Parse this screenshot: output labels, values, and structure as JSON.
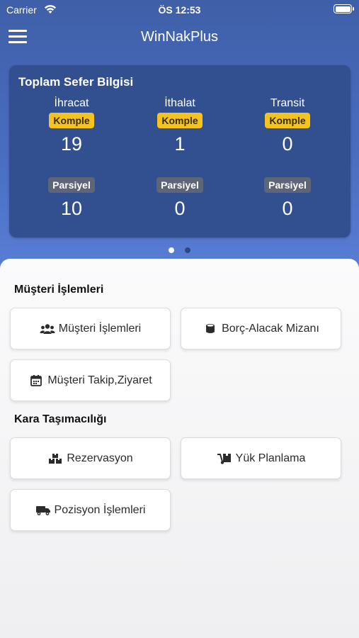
{
  "status_bar": {
    "carrier": "Carrier",
    "time": "ÖS 12:53"
  },
  "navbar": {
    "title": "WinNakPlus"
  },
  "summary": {
    "title": "Toplam Sefer Bilgisi",
    "columns": [
      {
        "label": "İhracat",
        "komple_badge": "Komple",
        "komple": "19",
        "parsiyel_badge": "Parsiyel",
        "parsiyel": "10"
      },
      {
        "label": "İthalat",
        "komple_badge": "Komple",
        "komple": "1",
        "parsiyel_badge": "Parsiyel",
        "parsiyel": "0"
      },
      {
        "label": "Transit",
        "komple_badge": "Komple",
        "komple": "0",
        "parsiyel_badge": "Parsiyel",
        "parsiyel": "0"
      }
    ]
  },
  "pager": {
    "pages": 2,
    "active": 1
  },
  "sections": {
    "customer": {
      "title": "Müşteri İşlemleri",
      "buttons": [
        {
          "label": "Müşteri İşlemleri",
          "icon": "users-icon"
        },
        {
          "label": "Borç-Alacak Mizanı",
          "icon": "coins-icon"
        },
        {
          "label": "Müşteri Takip,Ziyaret",
          "icon": "calendar-icon"
        }
      ]
    },
    "transport": {
      "title": "Kara Taşımacılığı",
      "buttons": [
        {
          "label": "Rezervasyon",
          "icon": "boxes-icon"
        },
        {
          "label": "Yük Planlama",
          "icon": "dolly-icon"
        },
        {
          "label": "Pozisyon İşlemleri",
          "icon": "truck-icon"
        }
      ]
    }
  },
  "colors": {
    "hero": "#4a6dc0",
    "card": "#32508f",
    "badge_yellow": "#f4c320",
    "badge_gray": "#5d6577"
  }
}
